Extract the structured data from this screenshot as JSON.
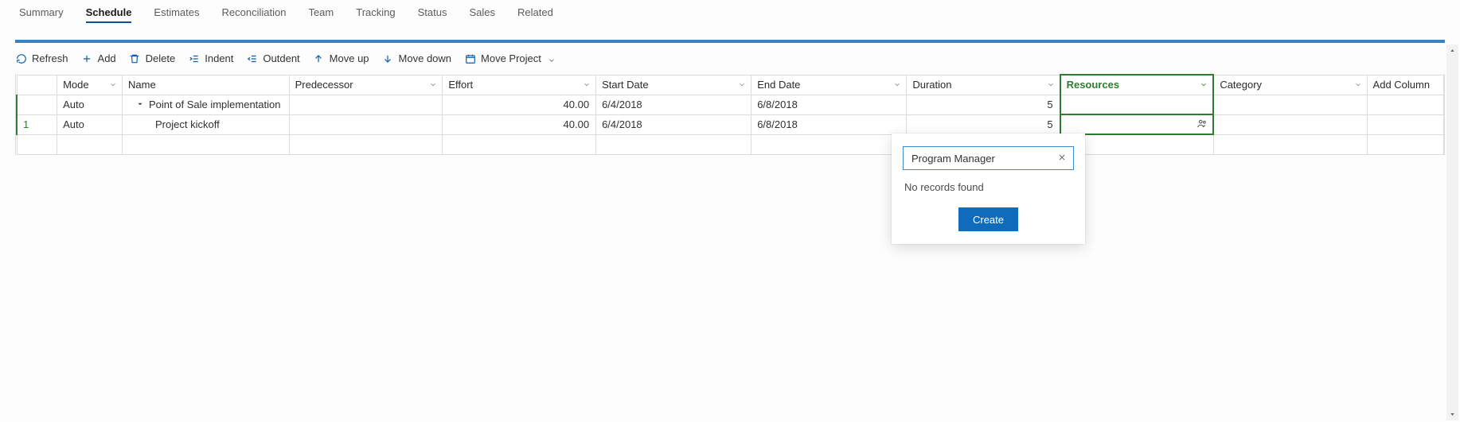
{
  "tabs": [
    {
      "label": "Summary",
      "active": false
    },
    {
      "label": "Schedule",
      "active": true
    },
    {
      "label": "Estimates",
      "active": false
    },
    {
      "label": "Reconciliation",
      "active": false
    },
    {
      "label": "Team",
      "active": false
    },
    {
      "label": "Tracking",
      "active": false
    },
    {
      "label": "Status",
      "active": false
    },
    {
      "label": "Sales",
      "active": false
    },
    {
      "label": "Related",
      "active": false
    }
  ],
  "toolbar": {
    "refresh": "Refresh",
    "add": "Add",
    "delete": "Delete",
    "indent": "Indent",
    "outdent": "Outdent",
    "moveup": "Move up",
    "movedown": "Move down",
    "moveproject": "Move Project"
  },
  "columns": {
    "mode": "Mode",
    "name": "Name",
    "predecessor": "Predecessor",
    "effort": "Effort",
    "start": "Start Date",
    "end": "End Date",
    "duration": "Duration",
    "resources": "Resources",
    "category": "Category",
    "addcolumn": "Add Column"
  },
  "rows": [
    {
      "idx": "",
      "mode": "Auto",
      "name": "Point of Sale implementation",
      "level": 1,
      "predecessor": "",
      "effort": "40.00",
      "start": "6/4/2018",
      "end": "6/8/2018",
      "duration": "5",
      "resources": "",
      "category": ""
    },
    {
      "idx": "1",
      "mode": "Auto",
      "name": "Project kickoff",
      "level": 2,
      "predecessor": "",
      "effort": "40.00",
      "start": "6/4/2018",
      "end": "6/8/2018",
      "duration": "5",
      "resources": "",
      "category": ""
    }
  ],
  "popup": {
    "search_value": "Program Manager",
    "message": "No records found",
    "create_label": "Create"
  }
}
